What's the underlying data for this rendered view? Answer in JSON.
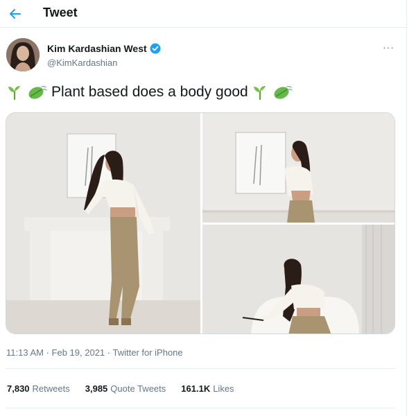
{
  "header": {
    "title": "Tweet"
  },
  "author": {
    "name": "Kim Kardashian West",
    "handle": "@KimKardashian",
    "verified": true
  },
  "more_label": "···",
  "tweet": {
    "text": "Plant based does a body good"
  },
  "media": [
    {
      "icon": "photo-woman-standing-fireplace"
    },
    {
      "icon": "photo-woman-back-view"
    },
    {
      "icon": "photo-woman-seated-chair"
    }
  ],
  "meta": {
    "time": "11:13 AM",
    "sep1": " · ",
    "date": "Feb 19, 2021",
    "sep2": " · ",
    "source": "Twitter for iPhone"
  },
  "stats": {
    "retweets_count": "7,830",
    "retweets_label": "Retweets",
    "quotes_count": "3,985",
    "quotes_label": "Quote Tweets",
    "likes_count": "161.1K",
    "likes_label": "Likes"
  },
  "colors": {
    "accent": "#1da1f2",
    "secondary_text": "#657786",
    "plant_green": "#4caf50"
  }
}
